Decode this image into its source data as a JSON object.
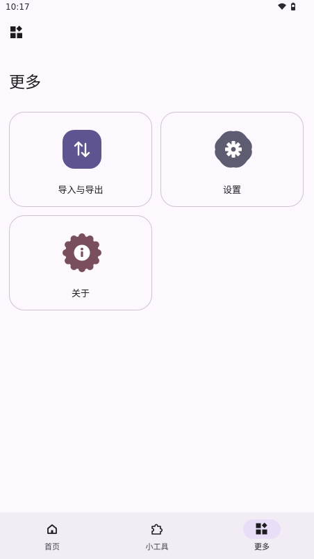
{
  "status_bar": {
    "time": "10:17"
  },
  "page": {
    "title": "更多"
  },
  "cards": [
    {
      "label": "导入与导出",
      "icon": "import-export-icon",
      "color": "#5e5590"
    },
    {
      "label": "设置",
      "icon": "settings-icon",
      "color": "#5e5c70"
    },
    {
      "label": "关于",
      "icon": "info-icon",
      "color": "#7a4f5d"
    }
  ],
  "bottom_nav": {
    "items": [
      {
        "label": "首页",
        "icon": "home-icon"
      },
      {
        "label": "小工具",
        "icon": "puzzle-icon"
      },
      {
        "label": "更多",
        "icon": "widgets-icon"
      }
    ],
    "active_index": 2
  }
}
